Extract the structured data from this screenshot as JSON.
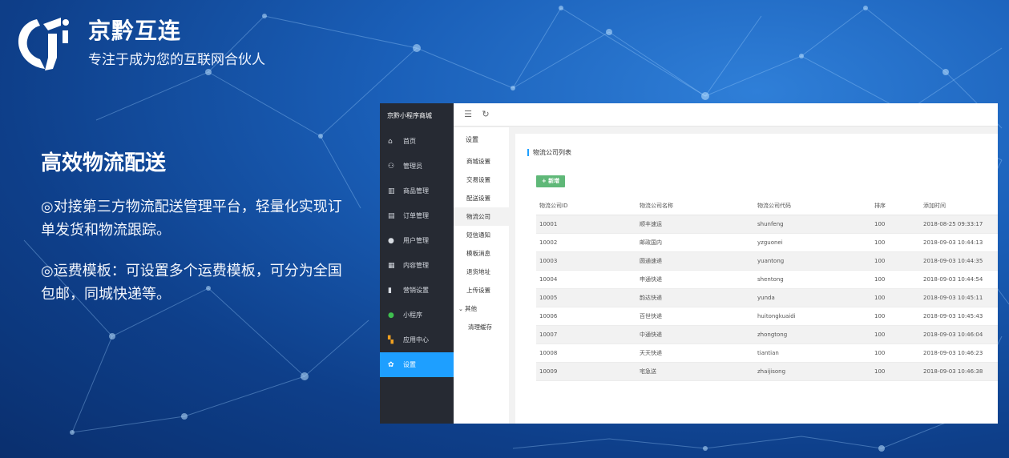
{
  "brand": {
    "name": "京黔互连",
    "slogan": "专注于成为您的互联网合伙人"
  },
  "feature": {
    "title": "高效物流配送",
    "para1": "◎对接第三方物流配送管理平台，轻量化实现订单发货和物流跟踪。",
    "para2": "◎运费模板：可设置多个运费模板，可分为全国包邮，同城快递等。"
  },
  "app": {
    "title": "京黔小程序商城",
    "sidebar": [
      {
        "label": "首页",
        "icon": "home-icon"
      },
      {
        "label": "管理员",
        "icon": "admin-icon"
      },
      {
        "label": "商品管理",
        "icon": "gift-icon"
      },
      {
        "label": "订单管理",
        "icon": "order-icon"
      },
      {
        "label": "用户管理",
        "icon": "user-icon"
      },
      {
        "label": "内容管理",
        "icon": "content-icon"
      },
      {
        "label": "营销设置",
        "icon": "marketing-icon"
      },
      {
        "label": "小程序",
        "icon": "miniprogram-icon"
      },
      {
        "label": "应用中心",
        "icon": "apps-icon"
      },
      {
        "label": "设置",
        "icon": "gear-icon",
        "active": true
      }
    ],
    "subnav": {
      "head": "设置",
      "items": [
        "商城设置",
        "交易设置",
        "配送设置",
        "物流公司",
        "短信通知",
        "模板消息",
        "退货地址",
        "上传设置"
      ],
      "group": "其他",
      "group_items": [
        "清理缓存"
      ]
    },
    "panel": {
      "title": "物流公司列表",
      "add_label": "新增",
      "columns": [
        "物流公司ID",
        "物流公司名称",
        "物流公司代码",
        "排序",
        "添加时间"
      ],
      "rows": [
        [
          "10001",
          "顺丰速运",
          "shunfeng",
          "100",
          "2018-08-25 09:33:17"
        ],
        [
          "10002",
          "邮政国内",
          "yzguonei",
          "100",
          "2018-09-03 10:44:13"
        ],
        [
          "10003",
          "圆通速递",
          "yuantong",
          "100",
          "2018-09-03 10:44:35"
        ],
        [
          "10004",
          "申通快递",
          "shentong",
          "100",
          "2018-09-03 10:44:54"
        ],
        [
          "10005",
          "韵达快递",
          "yunda",
          "100",
          "2018-09-03 10:45:11"
        ],
        [
          "10006",
          "百世快递",
          "huitongkuaidi",
          "100",
          "2018-09-03 10:45:43"
        ],
        [
          "10007",
          "中通快递",
          "zhongtong",
          "100",
          "2018-09-03 10:46:04"
        ],
        [
          "10008",
          "天天快递",
          "tiantian",
          "100",
          "2018-09-03 10:46:23"
        ],
        [
          "10009",
          "宅急送",
          "zhaijisong",
          "100",
          "2018-09-03 10:46:38"
        ]
      ]
    }
  },
  "colors": {
    "sidebar_bg": "#262a33",
    "active": "#1e9fff",
    "add_button": "#5fb878"
  }
}
